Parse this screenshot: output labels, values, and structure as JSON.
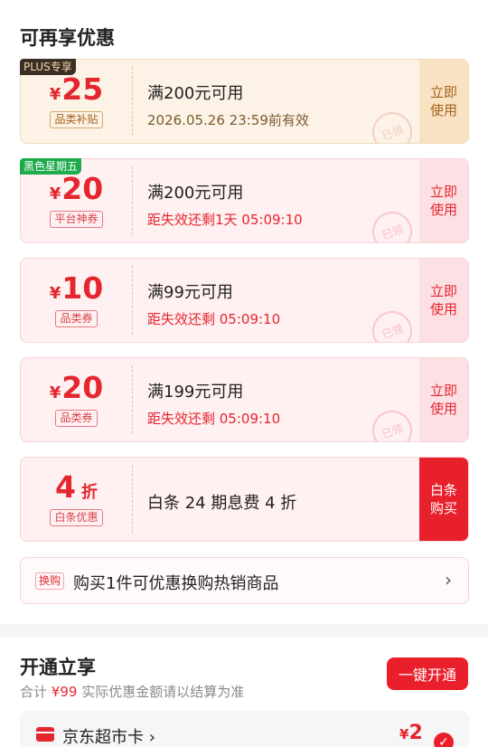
{
  "section_title": "可再享优惠",
  "coupons": [
    {
      "tag": "PLUS专享",
      "symbol": "¥",
      "amount": "25",
      "category": "品类补贴",
      "condition": "满200元可用",
      "expire": "2026.05.26 23:59前有效",
      "action": "立即使用",
      "stamp": "已领"
    },
    {
      "tag": "黑色星期五",
      "symbol": "¥",
      "amount": "20",
      "category": "平台神券",
      "condition": "满200元可用",
      "expire": "距失效还剩1天 05:09:10",
      "action": "立即使用",
      "stamp": "已领"
    },
    {
      "symbol": "¥",
      "amount": "10",
      "category": "品类券",
      "condition": "满99元可用",
      "expire": "距失效还剩 05:09:10",
      "action": "立即使用",
      "stamp": "已领"
    },
    {
      "symbol": "¥",
      "amount": "20",
      "category": "品类券",
      "condition": "满199元可用",
      "expire": "距失效还剩 05:09:10",
      "action": "立即使用",
      "stamp": "已领"
    },
    {
      "amount": "4",
      "unit": "折",
      "category": "白条优惠",
      "condition": "白条 24 期息费 4 折",
      "action": "白条购买"
    }
  ],
  "swap": {
    "badge": "换购",
    "text": "购买1件可优惠换购热销商品",
    "chevron": "›"
  },
  "open_section": {
    "title": "开通立享",
    "total_label": "合计",
    "total_value": "¥99",
    "note": "实际优惠金额请以结算为准",
    "button": "一键开通"
  },
  "card": {
    "name": "京东超市卡 ›",
    "symbol": "¥",
    "price": "2",
    "check": "✓"
  },
  "colors": {
    "accent": "#e4262f",
    "gold_bg": "#fcf3e6",
    "pink_bg": "#fff0f1"
  }
}
